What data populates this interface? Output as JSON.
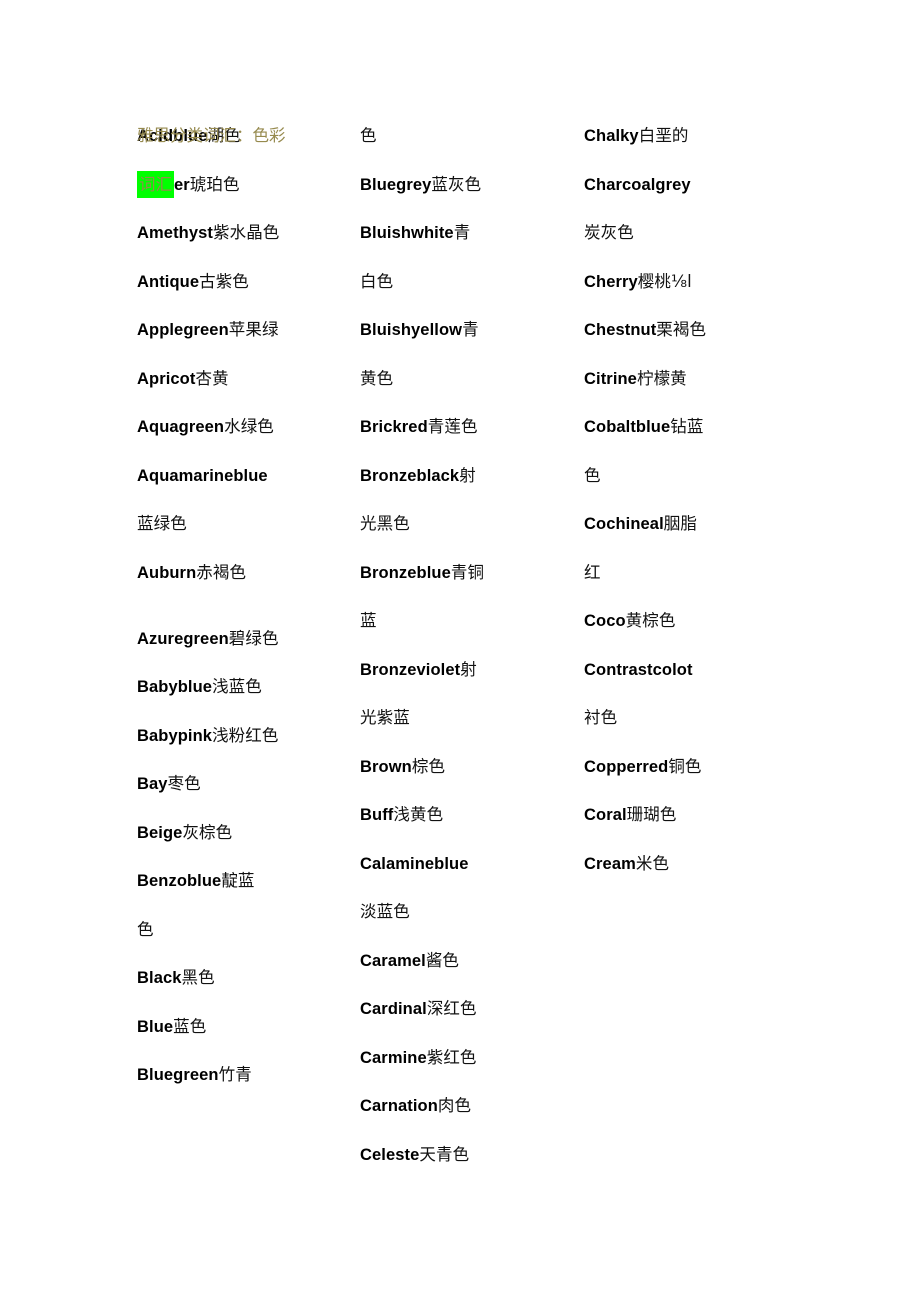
{
  "document": {
    "title_line1": "雅思分类词汇：色彩",
    "title_line2": "词汇",
    "title_color": "#968a4e",
    "highlight_color": "#00ff00",
    "body_color": "#000000",
    "background": "#ffffff"
  },
  "columns": [
    {
      "id": "column-1",
      "lines": [
        {
          "en": "Acidblue",
          "cn": "湖色"
        },
        {
          "en": "Amber",
          "cn": "琥珀色"
        },
        {
          "en": "Amethyst",
          "cn": "紫水晶色"
        },
        {
          "en": "Antique",
          "cn": "古紫色"
        },
        {
          "en": "Applegreen",
          "cn": "苹果绿"
        },
        {
          "en": "Apricot",
          "cn": "杏黄"
        },
        {
          "en": "Aquagreen",
          "cn": "水绿色"
        },
        {
          "en": "Aquamarineblue",
          "cn": ""
        },
        {
          "en": "",
          "cn": "蓝绿色"
        },
        {
          "en": "Auburn",
          "cn": "赤褐色"
        },
        {
          "en": "Azuregreen",
          "cn": "碧绿色"
        },
        {
          "en": "Babyblue",
          "cn": "浅蓝色"
        },
        {
          "en": "Babypink",
          "cn": "浅粉红色"
        },
        {
          "en": "Bay",
          "cn": "枣色"
        },
        {
          "en": "Beige",
          "cn": "灰棕色"
        },
        {
          "en": "Benzoblue",
          "cn": "靛蓝"
        },
        {
          "en": "",
          "cn": "色"
        },
        {
          "en": "Black",
          "cn": "黑色"
        },
        {
          "en": "Blue",
          "cn": "蓝色"
        },
        {
          "en": "Bluegreen",
          "cn": "竹青"
        }
      ]
    },
    {
      "id": "column-2",
      "lines": [
        {
          "en": "",
          "cn": "色"
        },
        {
          "en": "Bluegrey",
          "cn": "蓝灰色"
        },
        {
          "en": "Bluishwhite",
          "cn": "青"
        },
        {
          "en": "",
          "cn": "白色"
        },
        {
          "en": "Bluishyellow",
          "cn": "青"
        },
        {
          "en": "",
          "cn": "黄色"
        },
        {
          "en": "Brickred",
          "cn": "青莲色"
        },
        {
          "en": "Bronzeblack",
          "cn": "射"
        },
        {
          "en": "",
          "cn": "光黑色"
        },
        {
          "en": "Bronzeblue",
          "cn": "青铜"
        },
        {
          "en": "",
          "cn": "蓝"
        },
        {
          "en": "Bronzeviolet",
          "cn": "射"
        },
        {
          "en": "",
          "cn": "光紫蓝"
        },
        {
          "en": "Brown",
          "cn": "棕色"
        },
        {
          "en": "Buff",
          "cn": "浅黄色"
        },
        {
          "en": "Calamineblue",
          "cn": ""
        },
        {
          "en": "",
          "cn": "淡蓝色"
        },
        {
          "en": "Caramel",
          "cn": "酱色"
        },
        {
          "en": "Cardinal",
          "cn": "深红色"
        },
        {
          "en": "Carmine",
          "cn": "紫红色"
        },
        {
          "en": "Carnation",
          "cn": "肉色"
        },
        {
          "en": "Celeste",
          "cn": "天青色"
        }
      ]
    },
    {
      "id": "column-3",
      "lines": [
        {
          "en": "Chalky",
          "cn": "白垩的"
        },
        {
          "en": "Charcoalgrey",
          "cn": ""
        },
        {
          "en": "",
          "cn": "炭灰色"
        },
        {
          "en": "Cherry",
          "cn": "樱桃⅛l"
        },
        {
          "en": "Chestnut",
          "cn": "栗褐色"
        },
        {
          "en": "Citrine",
          "cn": "柠檬黄"
        },
        {
          "en": "Cobaltblue",
          "cn": "钻蓝"
        },
        {
          "en": "",
          "cn": "色"
        },
        {
          "en": "Cochineal",
          "cn": "胭脂"
        },
        {
          "en": "",
          "cn": "红"
        },
        {
          "en": "Coco",
          "cn": "黄棕色"
        },
        {
          "en": "Contrastcolot",
          "cn": ""
        },
        {
          "en": "",
          "cn": "衬色"
        },
        {
          "en": "Copperred",
          "cn": "铜色"
        },
        {
          "en": "Coral",
          "cn": "珊瑚色"
        },
        {
          "en": "Cream",
          "cn": "米色"
        }
      ]
    }
  ],
  "layout": {
    "gap_after": {
      "column-1": [
        9
      ]
    }
  }
}
